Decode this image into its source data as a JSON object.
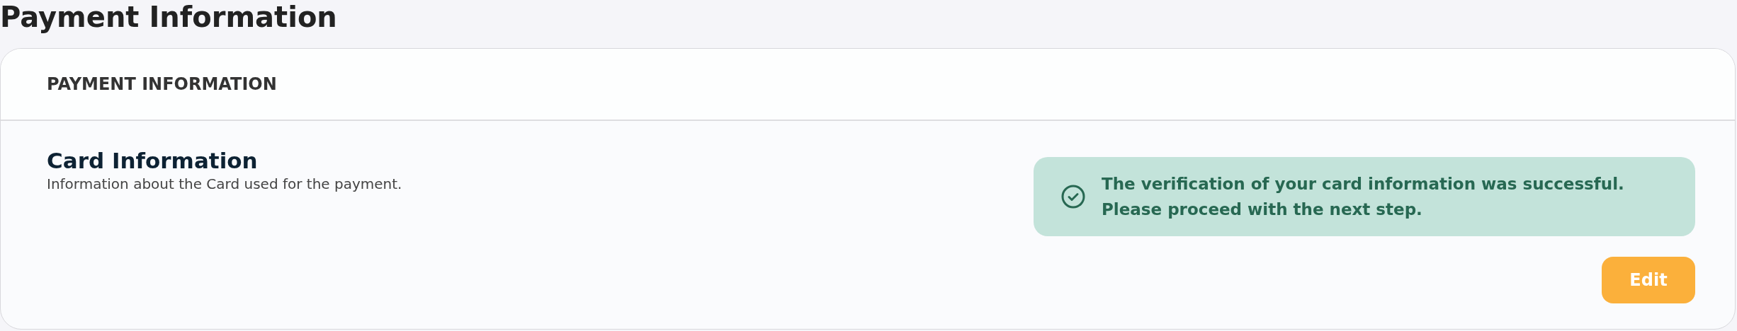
{
  "page_title": "Payment Information",
  "card": {
    "header": "PAYMENT INFORMATION",
    "section_title": "Card Information",
    "section_description": "Information about the Card used for the payment.",
    "alert": {
      "kind": "success",
      "lines": [
        "The verification of your card information was successful.",
        "Please proceed with the next step."
      ]
    },
    "buttons": [
      {
        "label": "Edit"
      }
    ]
  }
}
